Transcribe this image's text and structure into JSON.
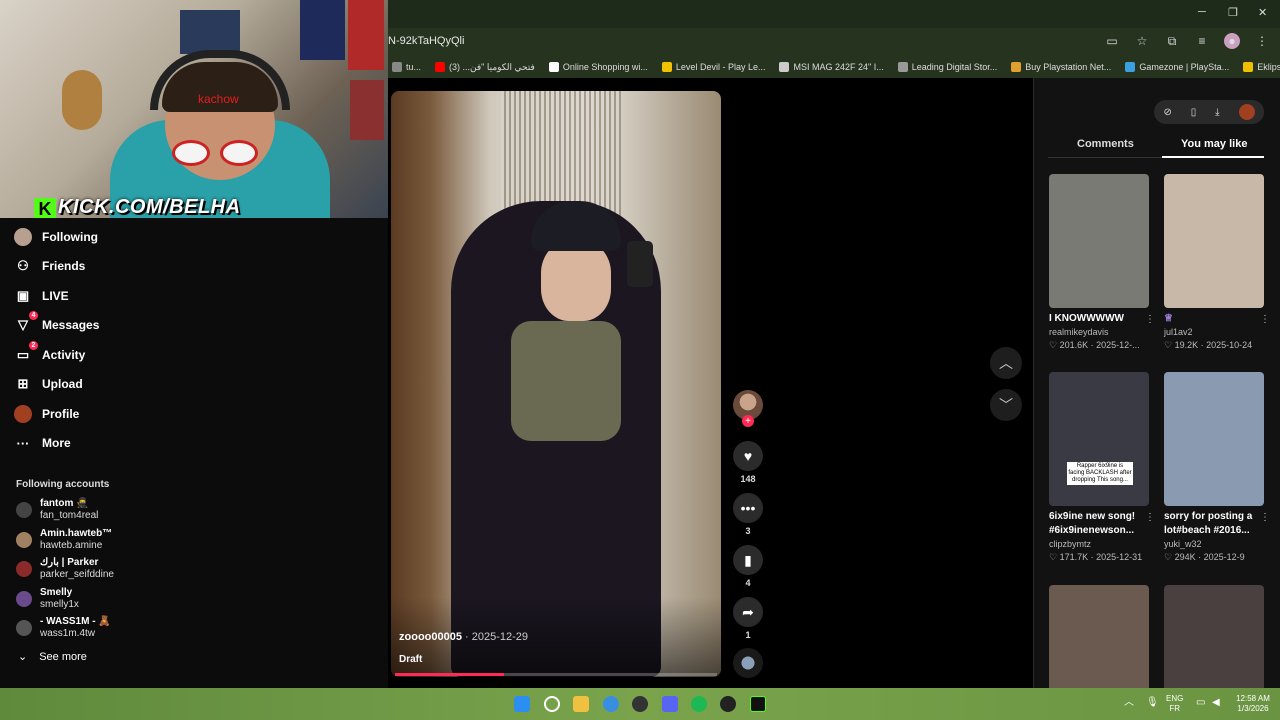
{
  "browser": {
    "url": "N-92kTaHQyQli",
    "window_controls": {
      "minimize": "─",
      "restore": "❐",
      "close": "✕"
    },
    "bookmarks": [
      {
        "label": "tu...",
        "color": "#888888"
      },
      {
        "label": "فتحي الكوميا \"فن... (3)",
        "color": "#ff0000"
      },
      {
        "label": "Online Shopping wi...",
        "color": "#ffffff"
      },
      {
        "label": "Level Devil - Play Le...",
        "color": "#f2c200"
      },
      {
        "label": "MSI MAG 242F 24\" I...",
        "color": "#cccccc"
      },
      {
        "label": "Leading Digital Stor...",
        "color": "#999999"
      },
      {
        "label": "Buy Playstation Net...",
        "color": "#e0a030"
      },
      {
        "label": "Gamezone | PlaySta...",
        "color": "#3aa0e0"
      },
      {
        "label": "Eklipse - Convert Tw...",
        "color": "#f0c000"
      }
    ]
  },
  "webcam": {
    "overlay_text": "KICK.COM/BELHA",
    "mini_text": "kachow"
  },
  "sidebar": {
    "nav": [
      {
        "label": "Following",
        "icon": "avatar",
        "badge": ""
      },
      {
        "label": "Friends",
        "icon": "friends-icon",
        "badge": ""
      },
      {
        "label": "LIVE",
        "icon": "live-icon",
        "badge": ""
      },
      {
        "label": "Messages",
        "icon": "messages-icon",
        "badge": "4"
      },
      {
        "label": "Activity",
        "icon": "activity-icon",
        "badge": "2"
      },
      {
        "label": "Upload",
        "icon": "upload-icon",
        "badge": ""
      },
      {
        "label": "Profile",
        "icon": "profile-avatar",
        "badge": ""
      },
      {
        "label": "More",
        "icon": "more-icon",
        "badge": ""
      }
    ],
    "following_header": "Following accounts",
    "accounts": [
      {
        "name": "fantom 🥷",
        "user": "fan_tom4real",
        "color": "#444444"
      },
      {
        "name": "Amin.hawteb™",
        "user": "hawteb.amine",
        "color": "#a08060"
      },
      {
        "name": "بارك | Parker",
        "user": "parker_seifddine",
        "color": "#8a2a2a"
      },
      {
        "name": "Smelly",
        "user": "smelly1x",
        "color": "#6a4a8a"
      },
      {
        "name": "- WASS1M - 🧸",
        "user": "wass1m.4tw",
        "color": "#555555"
      }
    ],
    "see_more": "See more"
  },
  "video": {
    "author": "zoooo00005",
    "date": "2025-12-29",
    "status": "Draft",
    "progress": 0.34,
    "likes": "148",
    "comments": "3",
    "saves": "4",
    "shares": "1"
  },
  "panel": {
    "tabs": {
      "comments": "Comments",
      "you_may_like": "You may like"
    },
    "cards": [
      {
        "title": "I KNOWWWWW",
        "user": "realmikeydavis",
        "likes": "201.6K",
        "date": "2025-12-...",
        "bg": "#7a7a74"
      },
      {
        "title": "",
        "user": "jul1av2",
        "likes": "19.2K",
        "date": "2025-10-24",
        "bg": "#c8b8a8"
      },
      {
        "title": "6ix9ine new song! #6ix9inenewson...",
        "user": "clipzbymtz",
        "likes": "171.7K",
        "date": "2025-12-31",
        "bg": "#3a3a44"
      },
      {
        "title": "sorry for posting a lot#beach #2016...",
        "user": "yuki_w32",
        "likes": "294K",
        "date": "2025-12-9",
        "bg": "#8a9ab0"
      },
      {
        "title": "",
        "user": "",
        "likes": "",
        "date": "",
        "bg": "#6a5a50"
      },
      {
        "title": "",
        "user": "",
        "likes": "",
        "date": "",
        "bg": "#4a4040"
      }
    ],
    "thumb_caption": "Rapper 6ix9ine is facing BACKLASH after dropping This song..."
  },
  "taskbar": {
    "lang_top": "ENG",
    "lang_bottom": "FR",
    "time": "12:58 AM",
    "date": "1/3/2026"
  }
}
